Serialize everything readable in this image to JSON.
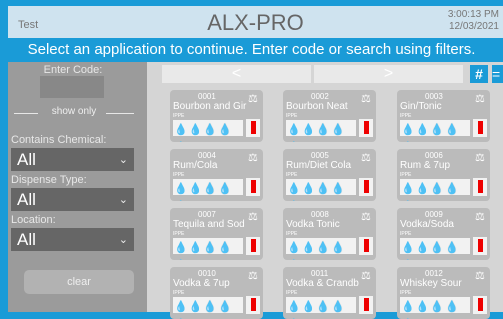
{
  "header": {
    "left_label": "Test",
    "title": "ALX-PRO",
    "time": "3:00:13 PM",
    "date": "12/03/2021"
  },
  "banner": "Select an application to continue. Enter code or search using filters.",
  "sidebar": {
    "enter_code_label": "Enter Code:",
    "show_only_label": "show only",
    "filters": [
      {
        "label": "Contains Chemical:",
        "value": "All"
      },
      {
        "label": "Dispense Type:",
        "value": "All"
      },
      {
        "label": "Location:",
        "value": "All"
      }
    ],
    "clear_label": "clear"
  },
  "nav": {
    "prev_label": "<",
    "next_label": ">",
    "hash_label": "#",
    "hash2_label": "="
  },
  "products": [
    {
      "number": "0001",
      "name": "Bourbon and Gir",
      "tag": "IPPE"
    },
    {
      "number": "0002",
      "name": "Bourbon Neat",
      "tag": "IPPE"
    },
    {
      "number": "0003",
      "name": "Gin/Tonic",
      "tag": "IPPE"
    },
    {
      "number": "0004",
      "name": "Rum/Cola",
      "tag": "IPPE"
    },
    {
      "number": "0005",
      "name": "Rum/Diet Cola",
      "tag": "IPPE"
    },
    {
      "number": "0006",
      "name": "Rum & 7up",
      "tag": "IPPE"
    },
    {
      "number": "0007",
      "name": "Tequila and Sod",
      "tag": "IPPE"
    },
    {
      "number": "0008",
      "name": "Vodka Tonic",
      "tag": "IPPE"
    },
    {
      "number": "0009",
      "name": "Vodka/Soda",
      "tag": "IPPE"
    },
    {
      "number": "0010",
      "name": "Vodka & 7up",
      "tag": "IPPE"
    },
    {
      "number": "0011",
      "name": "Vodka & Crandb",
      "tag": "IPPE"
    },
    {
      "number": "0012",
      "name": "Whiskey Sour",
      "tag": "IPPE"
    }
  ],
  "colors": {
    "accent": "#1a9bd7",
    "flag": "#e00000"
  }
}
